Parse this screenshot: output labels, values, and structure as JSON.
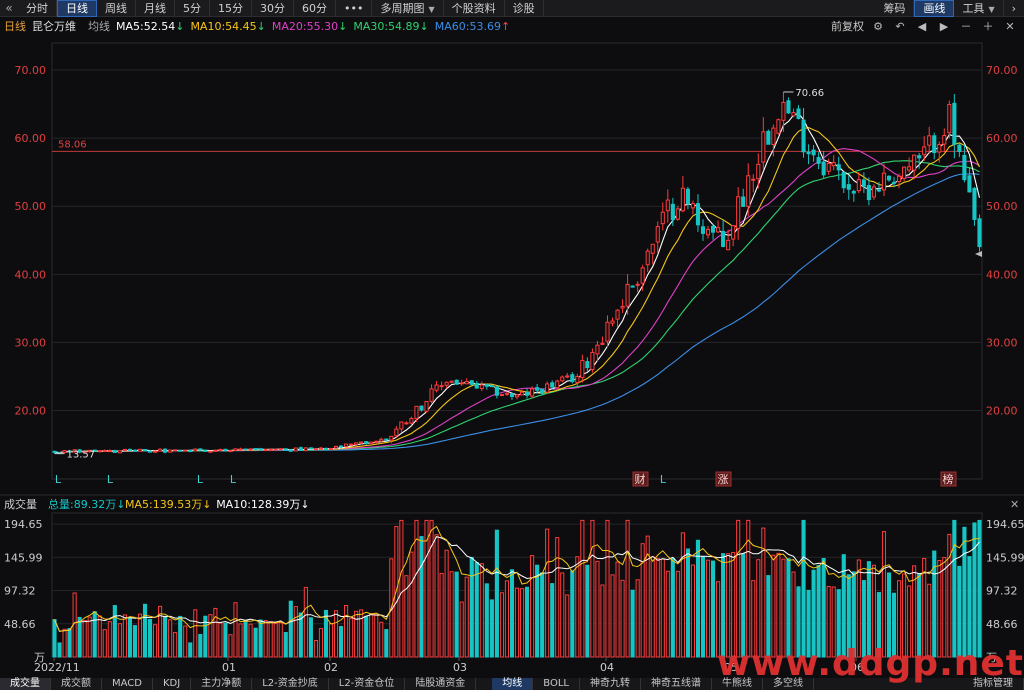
{
  "toolbar": {
    "back_icon": "double-chevron-left-icon",
    "items": [
      {
        "label": "分时",
        "active": false
      },
      {
        "label": "日线",
        "active": true
      },
      {
        "label": "周线",
        "active": false
      },
      {
        "label": "月线",
        "active": false
      },
      {
        "label": "5分",
        "active": false
      },
      {
        "label": "15分",
        "active": false
      },
      {
        "label": "30分",
        "active": false
      },
      {
        "label": "60分",
        "active": false
      },
      {
        "label": "•••",
        "active": false
      }
    ],
    "multi_period": "多周期图",
    "stock_info": "个股资料",
    "diagnose": "诊股",
    "right": {
      "chips": "筹码",
      "draw": "画线",
      "tools": "工具"
    }
  },
  "infobar": {
    "period": "日线",
    "stock_name": "昆仑万维",
    "avg_label": "均线",
    "ma": [
      {
        "label": "MA5:52.54",
        "arrow": "↓",
        "color": "#ffffff",
        "arrow_color": "#2fd36f"
      },
      {
        "label": "MA10:54.45",
        "arrow": "↓",
        "color": "#f5c518",
        "arrow_color": "#2fd36f"
      },
      {
        "label": "MA20:55.30",
        "arrow": "↓",
        "color": "#e040c8",
        "arrow_color": "#2fd36f"
      },
      {
        "label": "MA30:54.89",
        "arrow": "↓",
        "color": "#2fd36f",
        "arrow_color": "#2fd36f"
      },
      {
        "label": "MA60:53.69",
        "arrow": "↑",
        "color": "#3a8ee6",
        "arrow_color": "#ff4444"
      }
    ],
    "restore": "前复权"
  },
  "chart_data": [
    {
      "type": "candlestick",
      "price_axis": {
        "ticks": [
          20.0,
          30.0,
          40.0,
          50.0,
          60.0,
          70.0
        ],
        "ylim": [
          12.0,
          72.5
        ]
      },
      "reference_line": {
        "value": 58.06,
        "label": "58.06"
      },
      "annotations": [
        {
          "label": "70.66",
          "kind": "high"
        },
        {
          "label": "13.57",
          "kind": "low"
        }
      ],
      "event_markers": [
        "L",
        "L",
        "L",
        "L",
        "财",
        "L",
        "涨",
        "榜"
      ],
      "series_colors": {
        "up": "#ff3b3b",
        "down": "#17c4c4",
        "ma5": "#ffffff",
        "ma10": "#f5c518",
        "ma20": "#e040c8",
        "ma30": "#2fd36f",
        "ma60": "#3a8ee6"
      },
      "phases": [
        {
          "bars": 55,
          "from": 14.0,
          "to": 14.3,
          "vol": 0.018
        },
        {
          "bars": 12,
          "from": 14.3,
          "to": 15.8,
          "vol": 0.02
        },
        {
          "bars": 12,
          "from": 15.8,
          "to": 24.5,
          "vol": 0.04
        },
        {
          "bars": 14,
          "from": 24.5,
          "to": 22.0,
          "vol": 0.03
        },
        {
          "bars": 12,
          "from": 22.0,
          "to": 25.0,
          "vol": 0.03
        },
        {
          "bars": 12,
          "from": 25.0,
          "to": 40.0,
          "vol": 0.05
        },
        {
          "bars": 8,
          "from": 40.0,
          "to": 52.0,
          "vol": 0.05
        },
        {
          "bars": 9,
          "from": 52.0,
          "to": 44.0,
          "vol": 0.05
        },
        {
          "bars": 11,
          "from": 44.0,
          "to": 66.0,
          "vol": 0.05
        },
        {
          "bars": 7,
          "from": 66.0,
          "to": 58.0,
          "vol": 0.04
        },
        {
          "bars": 9,
          "from": 58.0,
          "to": 52.0,
          "vol": 0.04
        },
        {
          "bars": 12,
          "from": 52.0,
          "to": 56.5,
          "vol": 0.035
        },
        {
          "bars": 6,
          "from": 56.5,
          "to": 63.0,
          "vol": 0.035
        },
        {
          "bars": 6,
          "from": 63.0,
          "to": 43.5,
          "vol": 0.045
        }
      ]
    },
    {
      "type": "bar",
      "title": "成交量",
      "legend": [
        {
          "label": "总量:89.32万",
          "arrow": "↓",
          "color": "#17c4c4"
        },
        {
          "label": "MA5:139.53万",
          "arrow": "↓",
          "color": "#f5c518"
        },
        {
          "label": "MA10:128.39万",
          "arrow": "↓",
          "color": "#ffffff"
        }
      ],
      "volume_axis": {
        "ticks": [
          48.66,
          97.32,
          145.99,
          194.65
        ],
        "unit": "万",
        "ylim": [
          0,
          205
        ]
      },
      "x_labels": [
        "2022/11",
        "01",
        "02",
        "03",
        "04",
        "05",
        "06"
      ]
    }
  ],
  "bottom_tabs": {
    "left": [
      {
        "label": "成交量",
        "active": true
      },
      {
        "label": "成交额",
        "active": false
      },
      {
        "label": "MACD",
        "active": false
      },
      {
        "label": "KDJ",
        "active": false
      },
      {
        "label": "主力净额",
        "active": false
      },
      {
        "label": "L2-资金抄底",
        "active": false
      },
      {
        "label": "L2-资金仓位",
        "active": false
      },
      {
        "label": "陆股通资金",
        "active": false
      }
    ],
    "right": [
      {
        "label": "均线",
        "blue": true
      },
      {
        "label": "BOLL",
        "blue": false
      },
      {
        "label": "神奇九转",
        "blue": false
      },
      {
        "label": "神奇五线谱",
        "blue": false
      },
      {
        "label": "牛熊线",
        "blue": false
      },
      {
        "label": "多空线",
        "blue": false
      }
    ],
    "indicator_mgmt": "指标管理"
  },
  "watermark": "www.ddgp.net"
}
